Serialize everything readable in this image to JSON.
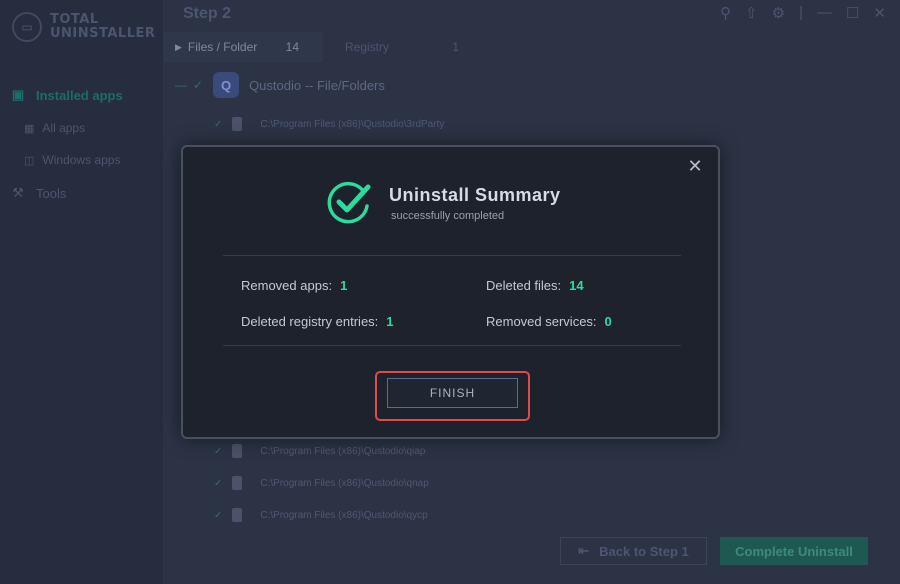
{
  "brand": {
    "line1": "TOTAL",
    "line2": "UNINSTALLER"
  },
  "sidebar": {
    "items": [
      {
        "label": "Installed apps",
        "icon": "box-icon"
      },
      {
        "label": "All apps",
        "icon": "grid-icon"
      },
      {
        "label": "Windows apps",
        "icon": "windows-icon"
      },
      {
        "label": "Tools",
        "icon": "wrench-icon"
      }
    ]
  },
  "header": {
    "title": "Step 2"
  },
  "tabs": [
    {
      "label": "Files / Folder",
      "count": "14"
    },
    {
      "label": "Registry",
      "count": "1"
    }
  ],
  "app": {
    "name": "Qustodio -- File/Folders"
  },
  "files": [
    "C:\\Program Files (x86)\\Qustodio\\3rdParty",
    "C:\\Program Files (x86)\\Qustodio\\qiap",
    "C:\\Program Files (x86)\\Qustodio\\qnap",
    "C:\\Program Files (x86)\\Qustodio\\qycp"
  ],
  "footer": {
    "back_label": "Back to Step 1",
    "complete_label": "Complete Uninstall"
  },
  "modal": {
    "title": "Uninstall Summary",
    "subtitle": "successfully completed",
    "stats": {
      "removed_apps": {
        "label": "Removed apps:",
        "value": "1"
      },
      "deleted_files": {
        "label": "Deleted files:",
        "value": "14"
      },
      "deleted_registry": {
        "label": "Deleted registry entries:",
        "value": "1"
      },
      "removed_services": {
        "label": "Removed services:",
        "value": "0"
      }
    },
    "finish_label": "FINISH"
  },
  "colors": {
    "accent_green": "#2ddc9a",
    "highlight_red": "#e04a48"
  }
}
